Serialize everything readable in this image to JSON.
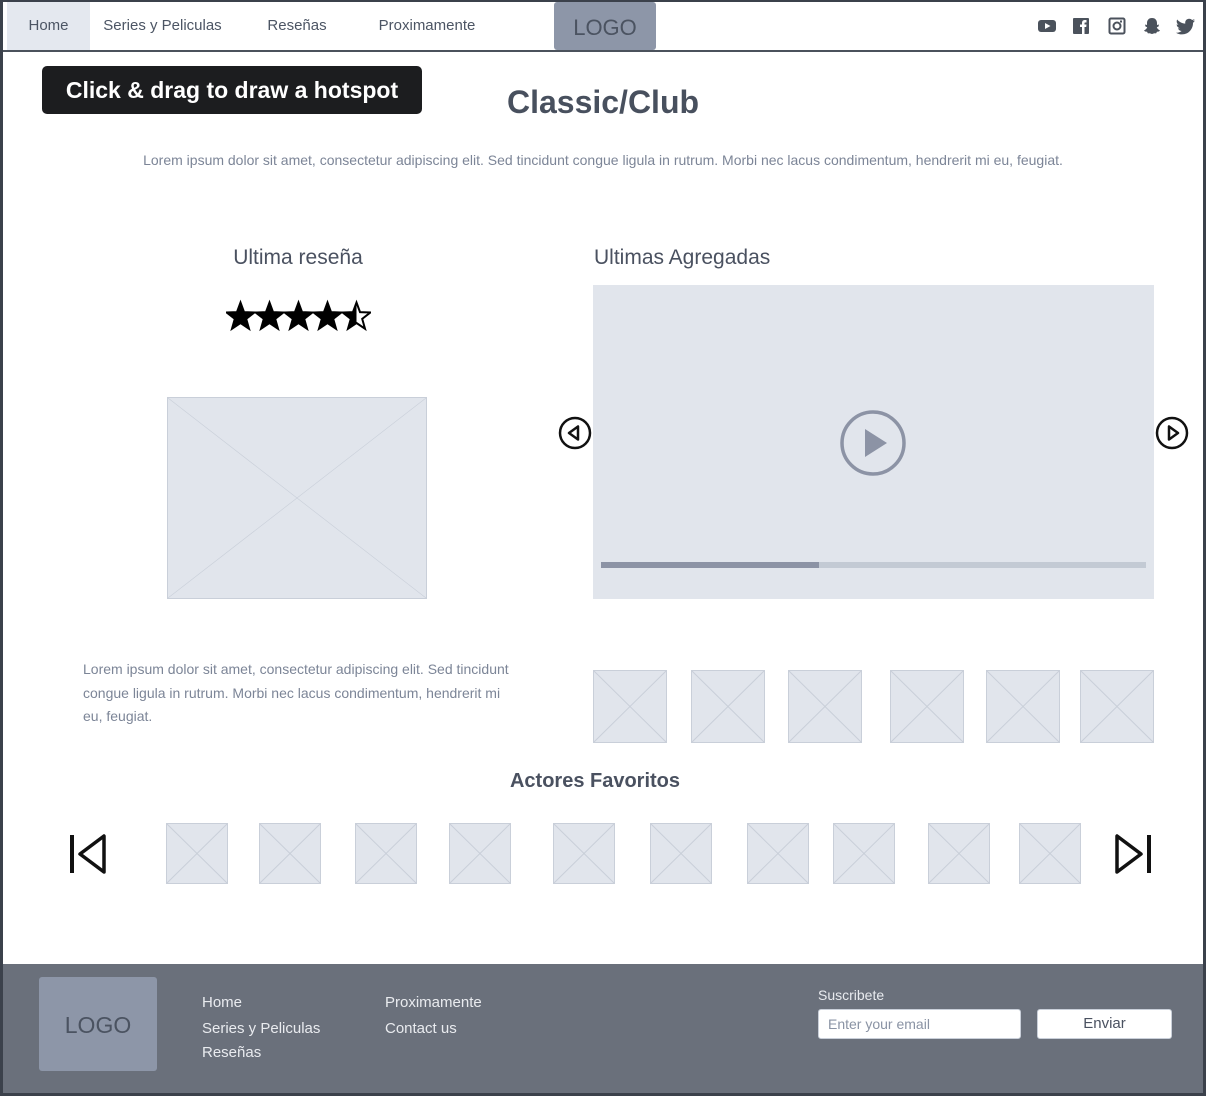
{
  "nav": {
    "items": [
      {
        "label": "Home",
        "active": true
      },
      {
        "label": "Series y Peliculas",
        "active": false
      },
      {
        "label": "Reseñas",
        "active": false
      },
      {
        "label": "Proximamente",
        "active": false
      }
    ],
    "logo": "LOGO",
    "social_icons": [
      "youtube-icon",
      "facebook-icon",
      "instagram-icon",
      "snapchat-icon",
      "twitter-icon"
    ]
  },
  "hotspot_tooltip": "Click & drag to draw a hotspot",
  "hero": {
    "title": "Classic/Club",
    "intro": "Lorem ipsum dolor sit amet, consectetur adipiscing elit. Sed tincidunt congue ligula in rutrum. Morbi nec lacus condimentum, hendrerit mi eu, feugiat."
  },
  "review": {
    "heading": "Ultima reseña",
    "rating": 4.5,
    "rating_max": 5,
    "text": "Lorem ipsum dolor sit amet, consectetur adipiscing elit. Sed tincidunt congue ligula in rutrum. Morbi nec lacus condimentum, hendrerit mi eu, feugiat."
  },
  "latest": {
    "heading": "Ultimas Agregadas",
    "video_progress": 0.4,
    "thumbnail_count": 6
  },
  "actors": {
    "heading": "Actores Favoritos",
    "thumbnail_count": 10
  },
  "footer": {
    "logo": "LOGO",
    "col1": [
      "Home",
      "Series y Peliculas",
      "Reseñas"
    ],
    "col2": [
      "Proximamente",
      "Contact us"
    ],
    "subscribe_label": "Suscribete",
    "email_placeholder": "Enter your email",
    "send_label": "Enviar"
  },
  "colors": {
    "nav_active_bg": "#e4e8ef",
    "logo_bg": "#8d96a8",
    "placeholder_bg": "#e1e5ec",
    "footer_bg": "#6a707b",
    "progress_fill": "#8c93a5"
  }
}
